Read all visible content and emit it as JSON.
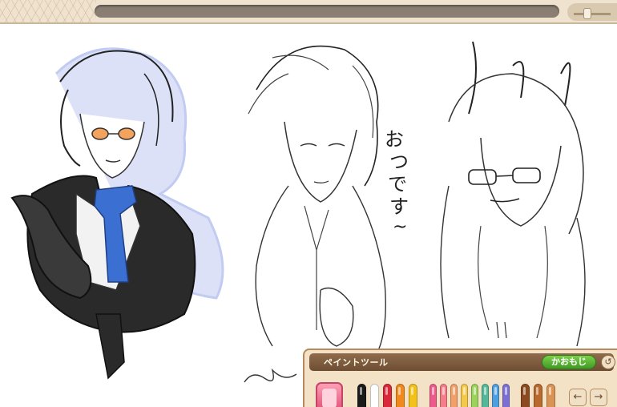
{
  "panel": {
    "title": "ペイントツール",
    "kaomoji_label": "かおもじ",
    "undo_icon": "↺",
    "prev_icon": "←",
    "next_icon": "→"
  },
  "canvas": {
    "handwritten": [
      "お",
      "つ",
      "で",
      "す",
      "~"
    ]
  },
  "palette": {
    "pens": [
      "#1a1a1a",
      "#ffffff",
      "#d8283a",
      "#f08a1f",
      "#f2c21b"
    ],
    "dots": [
      "#ee5a8c",
      "#f57d8a",
      "#f2a06a",
      "#f4c94a",
      "#9bd25c",
      "#53b89a",
      "#4d9fe0",
      "#7b6fd6"
    ],
    "browns": [
      "#8c4a22",
      "#b8692e",
      "#d99455"
    ]
  },
  "colors": {
    "accent_green": "#4caf2e",
    "panel_brown": "#7a5a3e",
    "tie_blue": "#3b6fd1",
    "hair_lavender": "#b8c2f0"
  }
}
